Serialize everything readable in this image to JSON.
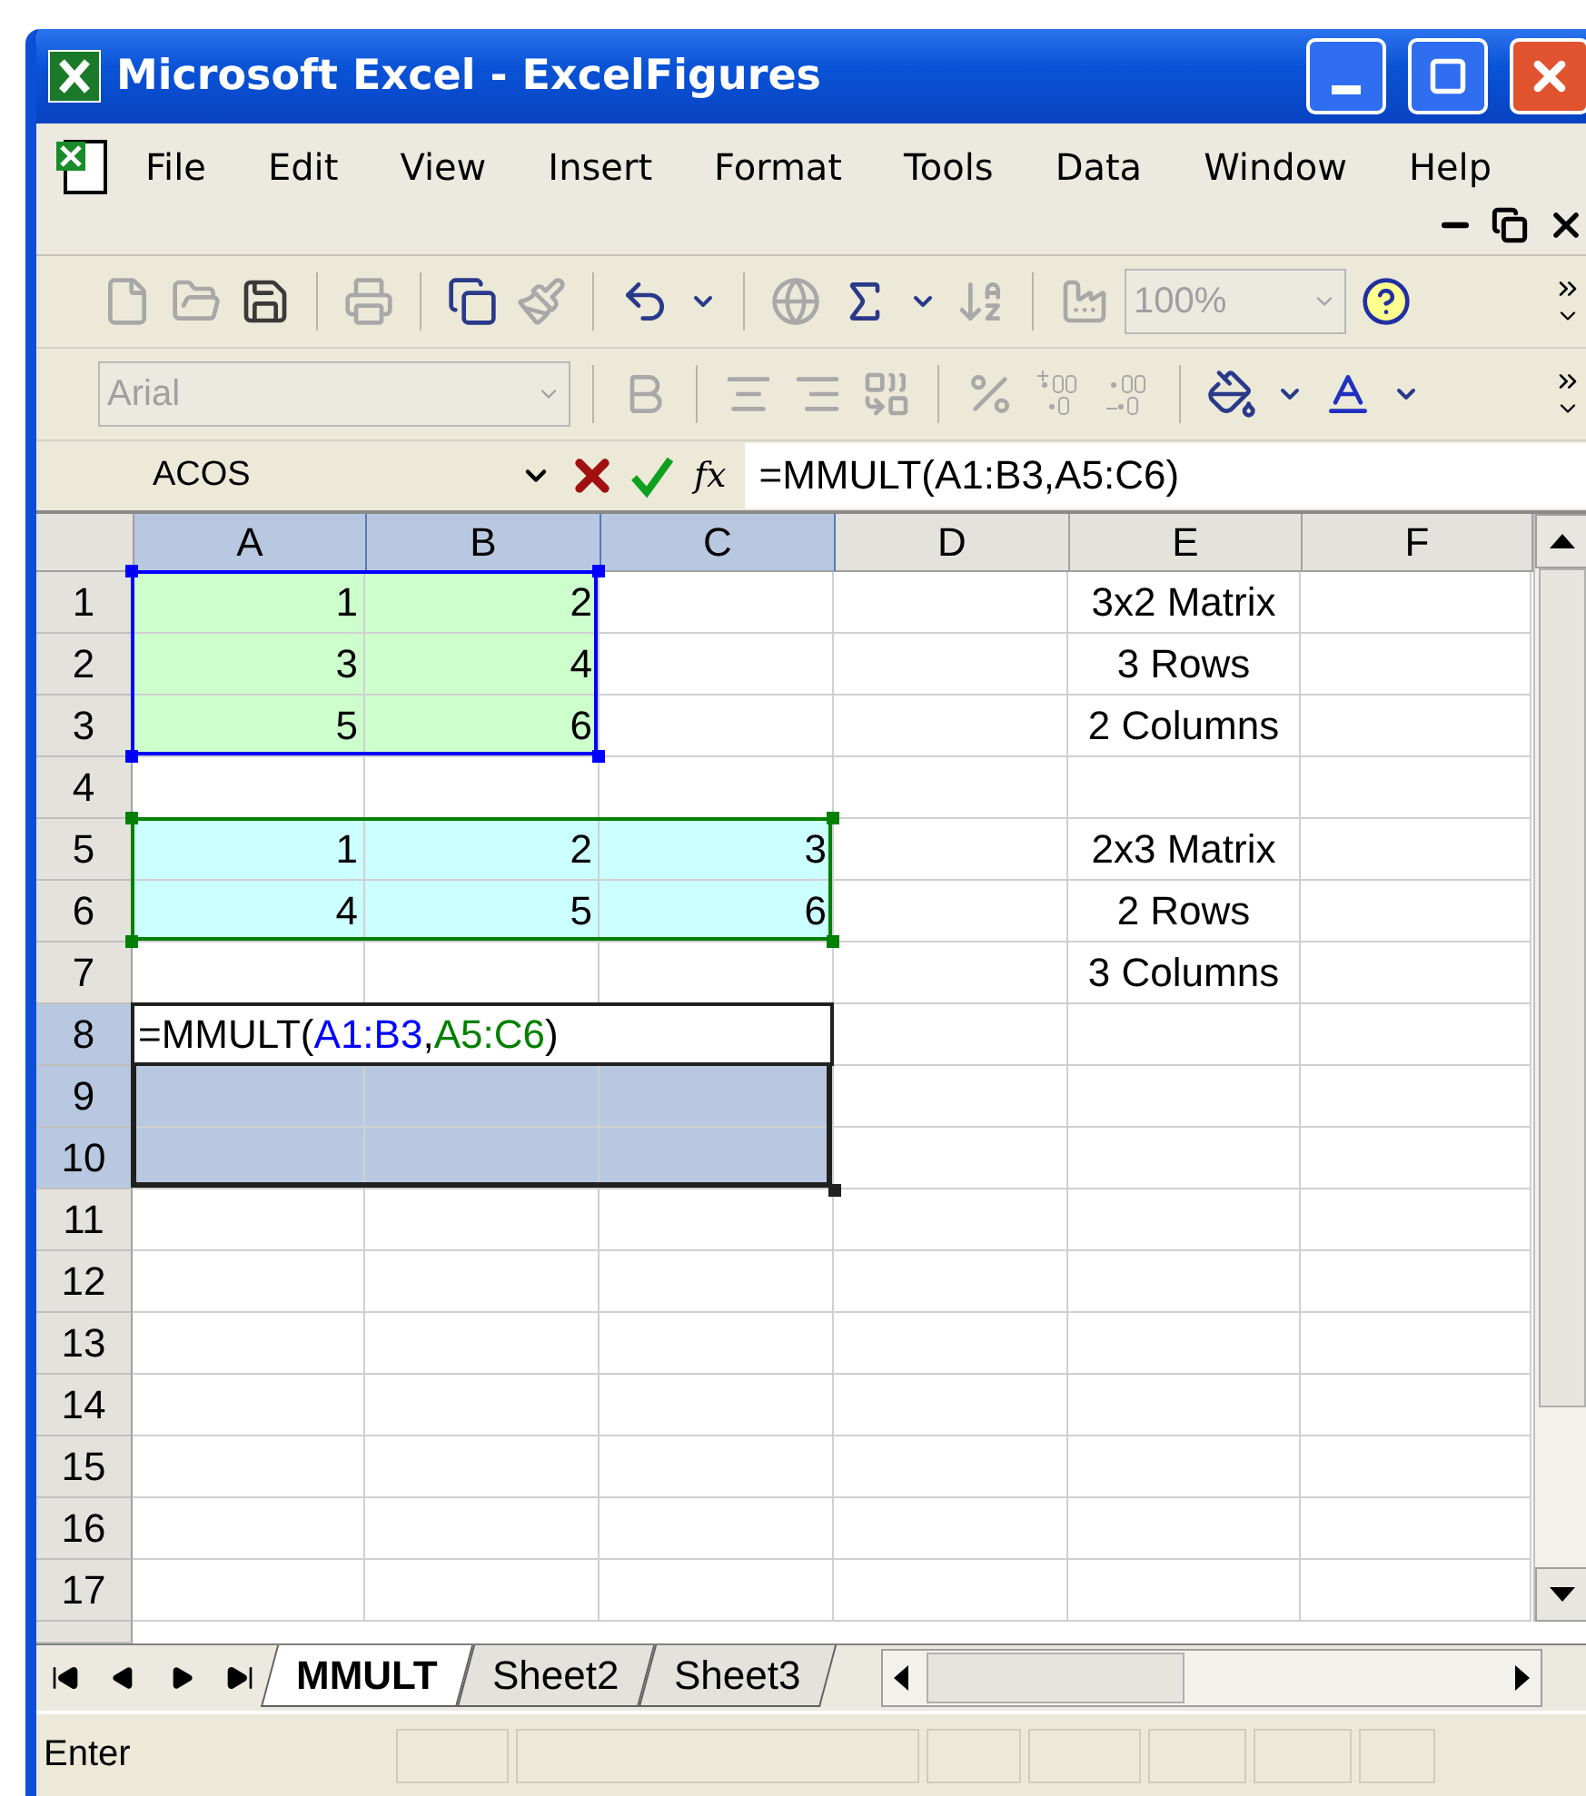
{
  "window": {
    "title": "Microsoft Excel - ExcelFigures"
  },
  "menu": [
    {
      "label": "File"
    },
    {
      "label": "Edit"
    },
    {
      "label": "View"
    },
    {
      "label": "Insert"
    },
    {
      "label": "Format"
    },
    {
      "label": "Tools"
    },
    {
      "label": "Data"
    },
    {
      "label": "Window"
    },
    {
      "label": "Help"
    }
  ],
  "standard_toolbar": [
    {
      "kind": "new",
      "disabled": true
    },
    {
      "kind": "open",
      "disabled": true
    },
    {
      "kind": "save",
      "disabled": false
    },
    {
      "kind": "sep"
    },
    {
      "kind": "print",
      "disabled": true
    },
    {
      "kind": "sep"
    },
    {
      "kind": "copy",
      "disabled": false
    },
    {
      "kind": "brush",
      "disabled": true
    },
    {
      "kind": "sep"
    },
    {
      "kind": "undo",
      "disabled": false
    },
    {
      "kind": "drop",
      "disabled": false
    },
    {
      "kind": "sep"
    },
    {
      "kind": "globe",
      "disabled": true
    },
    {
      "kind": "sum",
      "disabled": false
    },
    {
      "kind": "drop",
      "disabled": false
    },
    {
      "kind": "sort",
      "disabled": true
    },
    {
      "kind": "sep"
    },
    {
      "kind": "chart",
      "disabled": true
    },
    {
      "kind": "zoom",
      "value": "100%",
      "disabled": true
    },
    {
      "kind": "help",
      "disabled": false
    }
  ],
  "format_toolbar": [
    {
      "kind": "font",
      "value": "Arial",
      "disabled": true
    },
    {
      "kind": "sep"
    },
    {
      "kind": "bold",
      "disabled": true
    },
    {
      "kind": "sep"
    },
    {
      "kind": "center",
      "disabled": true
    },
    {
      "kind": "right",
      "disabled": true
    },
    {
      "kind": "merge",
      "disabled": true
    },
    {
      "kind": "sep"
    },
    {
      "kind": "percent",
      "disabled": true
    },
    {
      "kind": "incdec",
      "disabled": true
    },
    {
      "kind": "decdec",
      "disabled": true
    },
    {
      "kind": "sep"
    },
    {
      "kind": "fill",
      "disabled": false
    },
    {
      "kind": "drop",
      "disabled": false
    },
    {
      "kind": "fontcolor",
      "disabled": false
    },
    {
      "kind": "drop",
      "disabled": false
    }
  ],
  "formula_bar": {
    "name_box": "ACOS",
    "function_button": "fx",
    "formula": "=MMULT(A1:B3,A5:C6)"
  },
  "columns": [
    {
      "label": "A",
      "selected": true
    },
    {
      "label": "B",
      "selected": true
    },
    {
      "label": "C",
      "selected": true
    },
    {
      "label": "D",
      "selected": false
    },
    {
      "label": "E",
      "selected": false
    },
    {
      "label": "F",
      "selected": false
    }
  ],
  "rows": [
    {
      "header": "1",
      "selected": false,
      "cells": [
        {
          "text": "1",
          "kind": "number",
          "color": "#ccffcc",
          "range": {
            "color": "#0000ff"
          }
        },
        {
          "text": "2",
          "kind": "number",
          "color": "#ccffcc",
          "range": {
            "color": "#0000ff"
          }
        },
        {},
        {},
        {
          "text": "3x2 Matrix",
          "kind": "label"
        },
        {}
      ]
    },
    {
      "header": "2",
      "selected": false,
      "cells": [
        {
          "text": "3",
          "kind": "number",
          "color": "#ccffcc",
          "range": {
            "color": "#0000ff"
          }
        },
        {
          "text": "4",
          "kind": "number",
          "color": "#ccffcc",
          "range": {
            "color": "#0000ff"
          }
        },
        {},
        {},
        {
          "text": "3 Rows",
          "kind": "label"
        },
        {}
      ]
    },
    {
      "header": "3",
      "selected": false,
      "cells": [
        {
          "text": "5",
          "kind": "number",
          "color": "#ccffcc",
          "range": {
            "color": "#0000ff"
          }
        },
        {
          "text": "6",
          "kind": "number",
          "color": "#ccffcc",
          "range": {
            "color": "#0000ff"
          }
        },
        {},
        {},
        {
          "text": "2 Columns",
          "kind": "label"
        },
        {}
      ]
    },
    {
      "header": "4",
      "selected": false,
      "cells": [
        {},
        {},
        {},
        {},
        {},
        {}
      ]
    },
    {
      "header": "5",
      "selected": false,
      "cells": [
        {
          "text": "1",
          "kind": "number",
          "color": "#ccffff",
          "range": {
            "color": "#008000"
          }
        },
        {
          "text": "2",
          "kind": "number",
          "color": "#ccffff",
          "range": {
            "color": "#008000"
          }
        },
        {
          "text": "3",
          "kind": "number",
          "color": "#ccffff",
          "range": {
            "color": "#008000"
          }
        },
        {},
        {
          "text": "2x3 Matrix",
          "kind": "label"
        },
        {}
      ]
    },
    {
      "header": "6",
      "selected": false,
      "cells": [
        {
          "text": "4",
          "kind": "number",
          "color": "#ccffff",
          "range": {
            "color": "#008000"
          }
        },
        {
          "text": "5",
          "kind": "number",
          "color": "#ccffff",
          "range": {
            "color": "#008000"
          }
        },
        {
          "text": "6",
          "kind": "number",
          "color": "#ccffff",
          "range": {
            "color": "#008000"
          }
        },
        {},
        {
          "text": "2 Rows",
          "kind": "label"
        },
        {}
      ]
    },
    {
      "header": "7",
      "selected": false,
      "cells": [
        {},
        {},
        {},
        {},
        {
          "text": "3 Columns",
          "kind": "label"
        },
        {}
      ]
    },
    {
      "header": "8",
      "selected": true,
      "cells": [
        {
          "selected": true,
          "active": true,
          "segments": [
            {
              "text": "=MMULT(",
              "color": "#000000"
            },
            {
              "text": "A1:B3",
              "color": "#0000ff"
            },
            {
              "text": ",",
              "color": "#000000"
            },
            {
              "text": "A5:C6",
              "color": "#008000"
            },
            {
              "text": ")",
              "color": "#000000"
            }
          ]
        },
        {
          "selected": true
        },
        {
          "selected": true
        },
        {},
        {},
        {}
      ]
    },
    {
      "header": "9",
      "selected": true,
      "cells": [
        {
          "selected": true
        },
        {
          "selected": true
        },
        {
          "selected": true
        },
        {},
        {},
        {}
      ]
    },
    {
      "header": "10",
      "selected": true,
      "cells": [
        {
          "selected": true
        },
        {
          "selected": true
        },
        {
          "selected": true
        },
        {},
        {},
        {}
      ]
    },
    {
      "header": "11",
      "selected": false,
      "cells": [
        {},
        {},
        {},
        {},
        {},
        {}
      ]
    },
    {
      "header": "12",
      "selected": false,
      "cells": [
        {},
        {},
        {},
        {},
        {},
        {}
      ]
    },
    {
      "header": "13",
      "selected": false,
      "cells": [
        {},
        {},
        {},
        {},
        {},
        {}
      ]
    },
    {
      "header": "14",
      "selected": false,
      "cells": [
        {},
        {},
        {},
        {},
        {},
        {}
      ]
    },
    {
      "header": "15",
      "selected": false,
      "cells": [
        {},
        {},
        {},
        {},
        {},
        {}
      ]
    },
    {
      "header": "16",
      "selected": false,
      "cells": [
        {},
        {},
        {},
        {},
        {},
        {}
      ]
    },
    {
      "header": "17",
      "selected": false,
      "cells": [
        {},
        {},
        {},
        {},
        {},
        {}
      ]
    }
  ],
  "sheet_tabs": [
    {
      "label": "MMULT",
      "selected": true
    },
    {
      "label": "Sheet2",
      "selected": false
    },
    {
      "label": "Sheet3",
      "selected": false
    }
  ],
  "status_bar": {
    "mode": "Enter"
  }
}
